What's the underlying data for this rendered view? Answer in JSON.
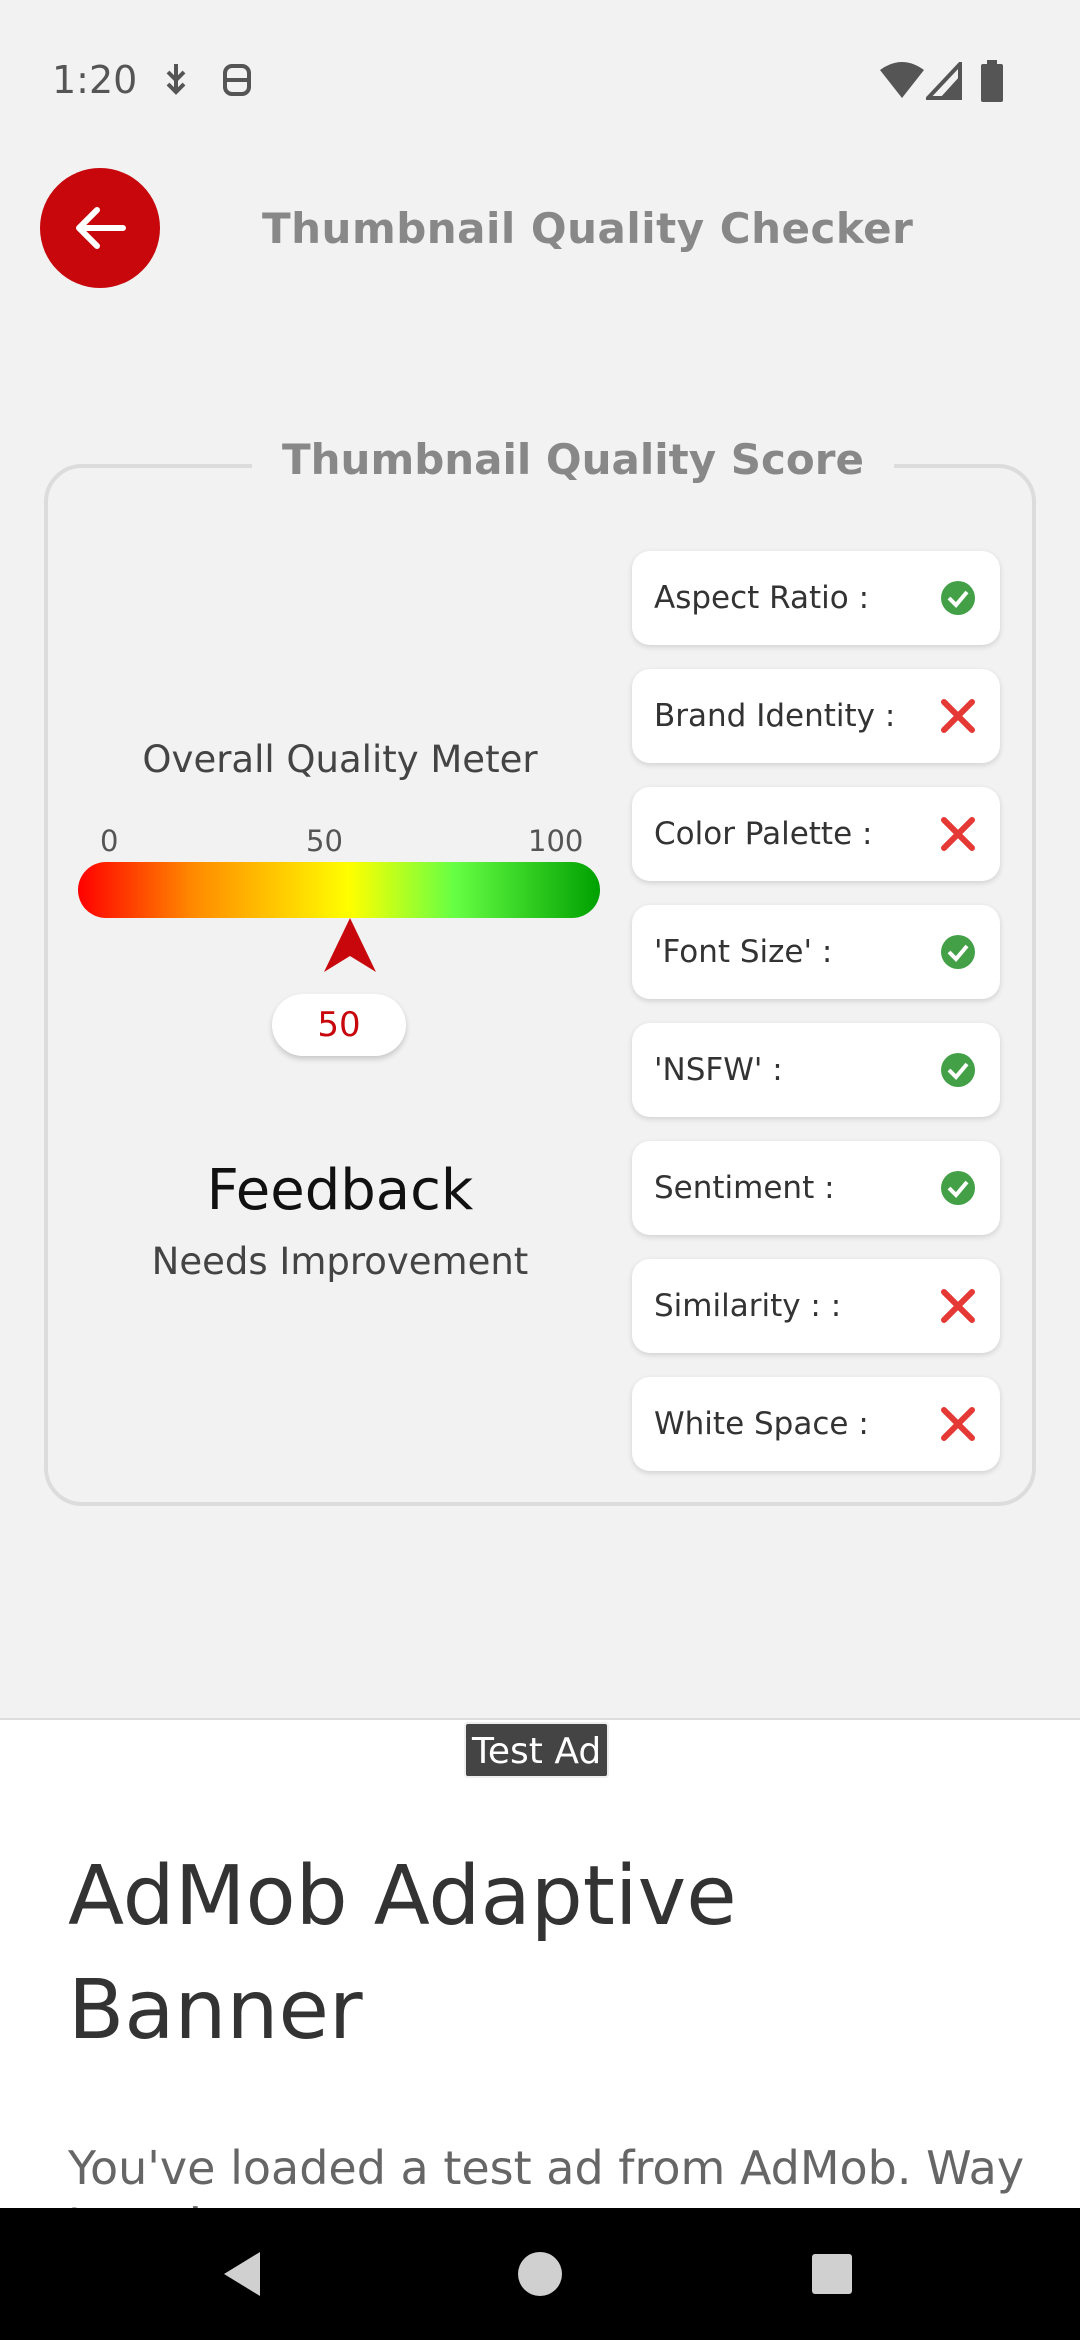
{
  "status_bar": {
    "time": "1:20",
    "icons": [
      "usb-debug-icon",
      "android-icon",
      "wifi-icon",
      "signal-icon",
      "battery-icon"
    ]
  },
  "header": {
    "back_icon": "arrow-left-icon",
    "title": "Thumbnail Quality Checker",
    "accent_color": "#c8070c"
  },
  "score_card": {
    "legend": "Thumbnail Quality Score",
    "meter": {
      "label": "Overall Quality Meter",
      "ticks": [
        "0",
        "50",
        "100"
      ],
      "value": 50,
      "value_text": "50"
    },
    "feedback": {
      "title": "Feedback",
      "text": "Needs Improvement"
    },
    "checks": [
      {
        "label": "Aspect Ratio :",
        "status": "pass",
        "icon": "check-circle-icon"
      },
      {
        "label": "Brand Identity :",
        "status": "fail",
        "icon": "cross-icon"
      },
      {
        "label": "Color Palette :",
        "status": "fail",
        "icon": "cross-icon"
      },
      {
        "label": "'Font Size' :",
        "status": "pass",
        "icon": "check-circle-icon"
      },
      {
        "label": "'NSFW' :",
        "status": "pass",
        "icon": "check-circle-icon"
      },
      {
        "label": "Sentiment :",
        "status": "pass",
        "icon": "check-circle-icon"
      },
      {
        "label": "Similarity : :",
        "status": "fail",
        "icon": "cross-icon"
      },
      {
        "label": "White Space :",
        "status": "fail",
        "icon": "cross-icon"
      }
    ],
    "colors": {
      "pass": "#43a047",
      "fail": "#e53935"
    }
  },
  "ad": {
    "badge": "Test Ad",
    "title": "AdMob Adaptive Banner",
    "body": "You've loaded a test ad from AdMob. Way to go!"
  },
  "nav_bar": {
    "icons": [
      "back-triangle-icon",
      "home-circle-icon",
      "recents-square-icon"
    ]
  }
}
